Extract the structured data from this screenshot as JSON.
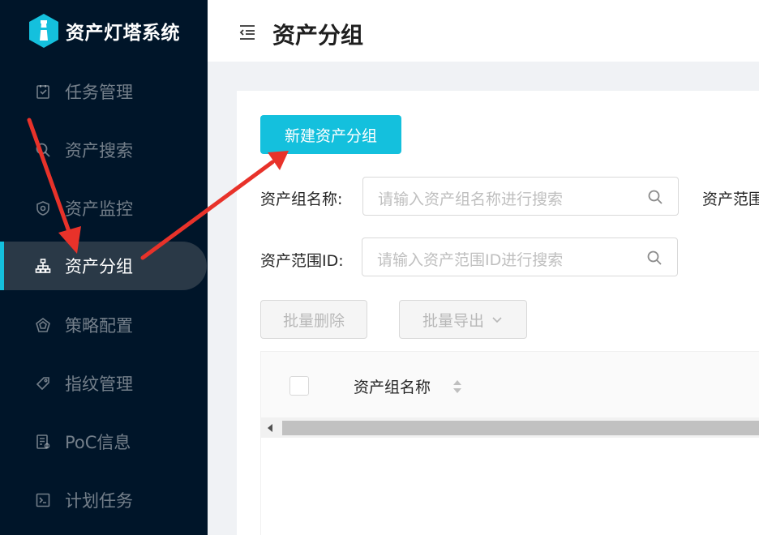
{
  "app": {
    "title": "资产灯塔系统"
  },
  "sidebar": {
    "items": [
      {
        "label": "任务管理",
        "icon": "task-icon"
      },
      {
        "label": "资产搜索",
        "icon": "search-icon"
      },
      {
        "label": "资产监控",
        "icon": "monitor-shield-icon"
      },
      {
        "label": "资产分组",
        "icon": "group-tree-icon",
        "active": true
      },
      {
        "label": "策略配置",
        "icon": "policy-icon"
      },
      {
        "label": "指纹管理",
        "icon": "tag-icon"
      },
      {
        "label": "PoC信息",
        "icon": "document-icon"
      },
      {
        "label": "计划任务",
        "icon": "terminal-icon"
      }
    ]
  },
  "header": {
    "title": "资产分组"
  },
  "toolbar": {
    "new_group_label": "新建资产分组"
  },
  "filters": {
    "group_name_label": "资产组名称:",
    "group_name_placeholder": "请输入资产组名称进行搜索",
    "scope_id_label": "资产范围ID:",
    "scope_id_placeholder": "请输入资产范围ID进行搜索",
    "scope_cut_label": "资产范围"
  },
  "batch": {
    "delete_label": "批量删除",
    "export_label": "批量导出"
  },
  "table": {
    "columns": [
      "资产组名称"
    ]
  },
  "colors": {
    "accent": "#14c0dd",
    "sidebar_bg": "#001529",
    "active_item_bg": "#2a3947",
    "annotation_arrow": "#e8322a"
  }
}
